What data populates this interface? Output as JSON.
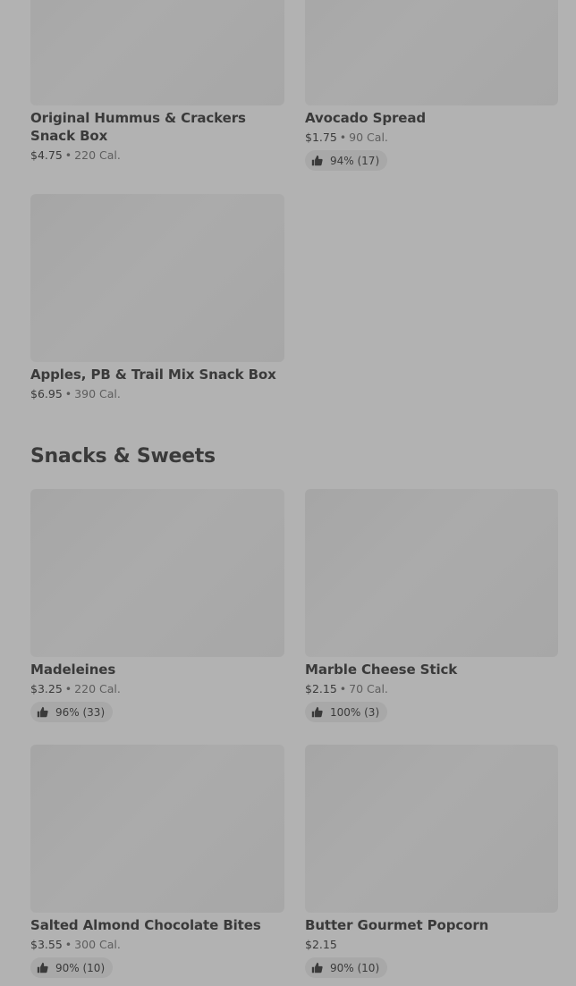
{
  "items_top": [
    {
      "name": "Original Hummus & Crackers Snack Box",
      "price": "$4.75",
      "calories": "220 Cal."
    },
    {
      "name": "Avocado Spread",
      "price": "$1.75",
      "calories": "90 Cal.",
      "rating": "94% (17)"
    },
    {
      "name": "Apples, PB & Trail Mix Snack Box",
      "price": "$6.95",
      "calories": "390 Cal."
    }
  ],
  "section": {
    "title": "Snacks & Sweets"
  },
  "items_snacks": [
    {
      "name": "Madeleines",
      "price": "$3.25",
      "calories": "220 Cal.",
      "rating": "96% (33)"
    },
    {
      "name": "Marble Cheese Stick",
      "price": "$2.15",
      "calories": "70 Cal.",
      "rating": "100% (3)"
    },
    {
      "name": "Salted Almond Chocolate Bites",
      "price": "$3.55",
      "calories": "300 Cal.",
      "rating": "90% (10)"
    },
    {
      "name": "Butter Gourmet Popcorn",
      "price": "$2.15",
      "rating": "90% (10)"
    }
  ],
  "separator": "•",
  "icons": {
    "rating": "thumbs-up-icon"
  }
}
